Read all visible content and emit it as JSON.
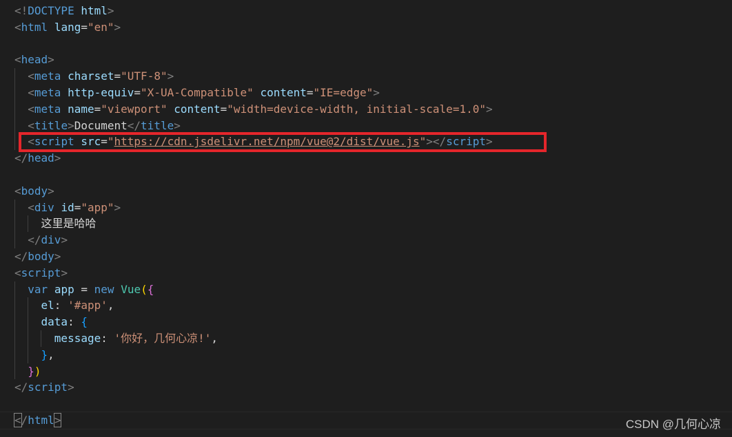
{
  "editor": {
    "theme_colors": {
      "background": "#1e1e1e",
      "tag": "#569cd6",
      "attribute": "#9cdcfe",
      "string": "#ce9178",
      "punctuation": "#808080",
      "highlight_border": "#e5262b"
    },
    "lines": {
      "l1": {
        "punct_open": "<!",
        "tag": "DOCTYPE",
        "attr": " html",
        "punct_close": ">"
      },
      "l2": {
        "tag": "html",
        "attr": "lang",
        "value": "\"en\""
      },
      "l4": {
        "tag": "head"
      },
      "l5": {
        "tag": "meta",
        "attr": "charset",
        "value": "\"UTF-8\""
      },
      "l6": {
        "tag": "meta",
        "attr1": "http-equiv",
        "value1": "\"X-UA-Compatible\"",
        "attr2": "content",
        "value2": "\"IE=edge\""
      },
      "l7": {
        "tag": "meta",
        "attr1": "name",
        "value1": "\"viewport\"",
        "attr2": "content",
        "value2": "\"width=device-width, initial-scale=1.0\""
      },
      "l8": {
        "tag": "title",
        "text": "Document"
      },
      "l9": {
        "tag": "script",
        "attr": "src",
        "quote": "\"",
        "url": "https://cdn.jsdelivr.net/npm/vue@2/dist/vue.js"
      },
      "l10": {
        "tag": "head"
      },
      "l12": {
        "tag": "body"
      },
      "l13": {
        "tag": "div",
        "attr": "id",
        "value": "\"app\""
      },
      "l14": {
        "text": "这里是哈哈"
      },
      "l15": {
        "tag": "div"
      },
      "l16": {
        "tag": "body"
      },
      "l17": {
        "tag": "script"
      },
      "l18": {
        "kw_var": "var",
        "name": "app",
        "eq": "=",
        "kw_new": "new",
        "cls": "Vue"
      },
      "l19": {
        "key": "el",
        "value": "'#app'"
      },
      "l20": {
        "key": "data"
      },
      "l21": {
        "key": "message",
        "value": "'你好，几何心凉!'"
      },
      "l24": {
        "tag": "script"
      },
      "l26": {
        "tag": "html"
      }
    }
  },
  "watermark": "CSDN @几何心凉"
}
